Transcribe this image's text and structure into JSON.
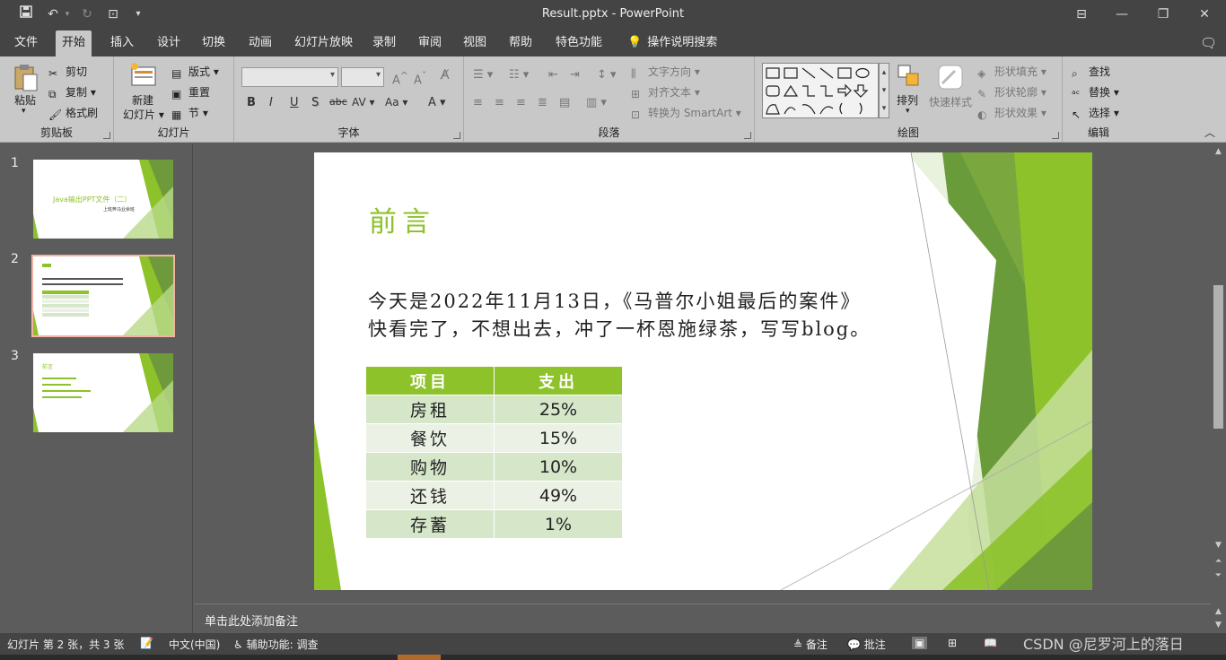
{
  "titlebar": {
    "title": "Result.pptx  -  PowerPoint",
    "icons": [
      "save-icon",
      "undo-icon",
      "redo-icon",
      "start-from-beginning-icon",
      "customize-qat-icon"
    ]
  },
  "tabs": [
    "文件",
    "开始",
    "插入",
    "设计",
    "切换",
    "动画",
    "幻灯片放映",
    "录制",
    "审阅",
    "视图",
    "帮助",
    "特色功能",
    "操作说明搜索"
  ],
  "active_tab": "开始",
  "ribbon": {
    "clipboard": {
      "paste": "粘贴",
      "cut": "剪切",
      "copy": "复制",
      "format_painter": "格式刷",
      "label": "剪贴板"
    },
    "slides": {
      "new_slide": "新建",
      "new_slide2": "幻灯片",
      "layout": "版式",
      "reset": "重置",
      "section": "节",
      "label": "幻灯片"
    },
    "font": {
      "label": "字体",
      "bold": "B",
      "italic": "I",
      "underline": "U",
      "shadow": "S",
      "strike": "abc",
      "spacing": "AV",
      "case": "Aa",
      "color": "A"
    },
    "paragraph": {
      "label": "段落",
      "text_direction": "文字方向",
      "align_text": "对齐文本",
      "smartart": "转换为 SmartArt"
    },
    "drawing": {
      "arrange": "排列",
      "quick_styles": "快速样式",
      "shape_fill": "形状填充",
      "shape_outline": "形状轮廓",
      "shape_effects": "形状效果",
      "label": "绘图"
    },
    "editing": {
      "find": "查找",
      "replace": "替换",
      "select": "选择",
      "label": "编辑"
    }
  },
  "thumbnails": [
    {
      "number": "1",
      "title": "Java输出PPT文件（二）",
      "subtitle": "上班奔马业余班"
    },
    {
      "number": "2"
    },
    {
      "number": "3",
      "title": "前言"
    }
  ],
  "slide": {
    "title": "前言",
    "lines": [
      "今天是2022年11月13日，《马普尔小姐最后的案件》",
      "快看完了，不想出去，冲了一杯恩施绿茶，写写blog。"
    ],
    "table": {
      "headers": [
        "项目",
        "支出"
      ],
      "rows": [
        [
          "房租",
          "25%"
        ],
        [
          "餐饮",
          "15%"
        ],
        [
          "购物",
          "10%"
        ],
        [
          "还钱",
          "49%"
        ],
        [
          "存蓄",
          "1%"
        ]
      ]
    }
  },
  "notes_placeholder": "单击此处添加备注",
  "status": {
    "slide_info": "幻灯片 第 2 张，共 3 张",
    "language": "中文(中国)",
    "accessibility": "辅助功能: 调查",
    "notes": "备注",
    "comments": "批注"
  },
  "watermark": "CSDN @尼罗河上的落日",
  "colors": {
    "accent": "#8dc22a",
    "table_odd": "#d5e6c9",
    "table_even": "#ebf2e5",
    "titlebar": "#444444",
    "ribbon": "#c8c8c8"
  }
}
